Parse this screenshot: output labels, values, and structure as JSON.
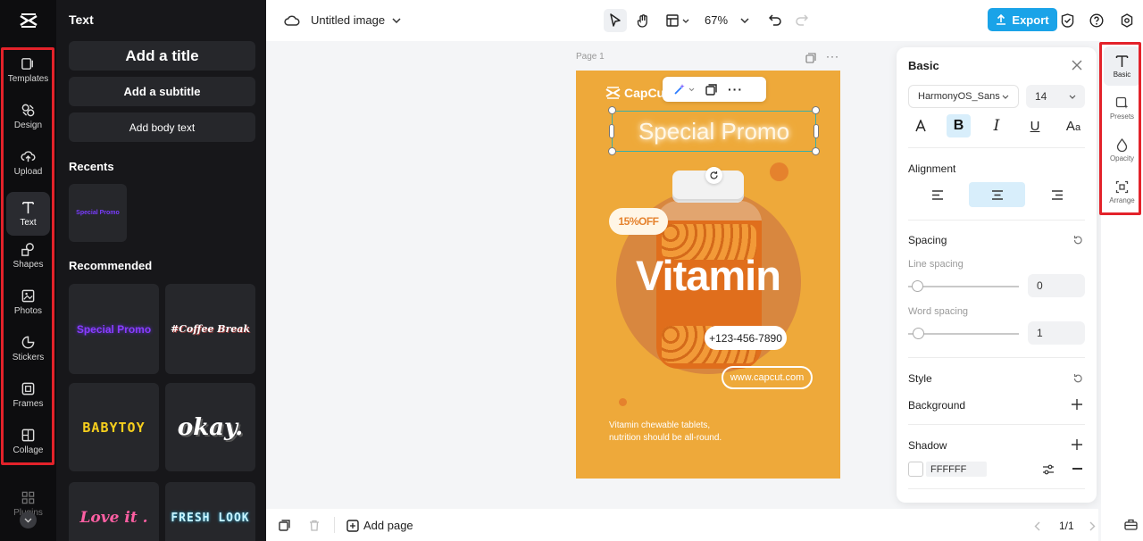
{
  "rail": {
    "items": [
      {
        "label": "Templates",
        "icon": "templates-icon"
      },
      {
        "label": "Design",
        "icon": "design-icon"
      },
      {
        "label": "Upload",
        "icon": "upload-icon"
      },
      {
        "label": "Text",
        "icon": "text-icon"
      },
      {
        "label": "Shapes",
        "icon": "shapes-icon"
      },
      {
        "label": "Photos",
        "icon": "photos-icon"
      },
      {
        "label": "Stickers",
        "icon": "stickers-icon"
      },
      {
        "label": "Frames",
        "icon": "frames-icon"
      },
      {
        "label": "Collage",
        "icon": "collage-icon"
      }
    ],
    "plugins_label": "Plugins"
  },
  "panel": {
    "title": "Text",
    "add_title": "Add a title",
    "add_subtitle": "Add a subtitle",
    "add_body": "Add body text",
    "recents_title": "Recents",
    "recent_item": "Special Promo",
    "recommended_title": "Recommended",
    "recommended": [
      "Special Promo",
      "#Coffee Break",
      "BABYTOY",
      "okay.",
      "Love it .",
      "FRESH LOOK"
    ]
  },
  "topbar": {
    "doc_title": "Untitled image",
    "zoom": "67%",
    "export_label": "Export",
    "accent": "#1aa3e8"
  },
  "canvas": {
    "page_label": "Page 1",
    "logo_text": "CapCut",
    "headline": "Special Promo",
    "discount": "15%OFF",
    "product": "Vitamin",
    "phone": "+123-456-7890",
    "website": "www.capcut.com",
    "tagline_1": "Vitamin chewable tablets,",
    "tagline_2": "nutrition should be all-round.",
    "bg_color": "#eea93a"
  },
  "props": {
    "title": "Basic",
    "font": "HarmonyOS_Sans",
    "font_size": "14",
    "alignment_label": "Alignment",
    "spacing_label": "Spacing",
    "line_spacing_label": "Line spacing",
    "line_spacing_value": "0",
    "word_spacing_label": "Word spacing",
    "word_spacing_value": "1",
    "style_label": "Style",
    "background_label": "Background",
    "shadow_label": "Shadow",
    "shadow_color": "FFFFFF"
  },
  "rrail": {
    "items": [
      {
        "label": "Basic"
      },
      {
        "label": "Presets"
      },
      {
        "label": "Opacity"
      },
      {
        "label": "Arrange"
      }
    ]
  },
  "bottombar": {
    "add_page": "Add page",
    "page_count": "1/1"
  }
}
